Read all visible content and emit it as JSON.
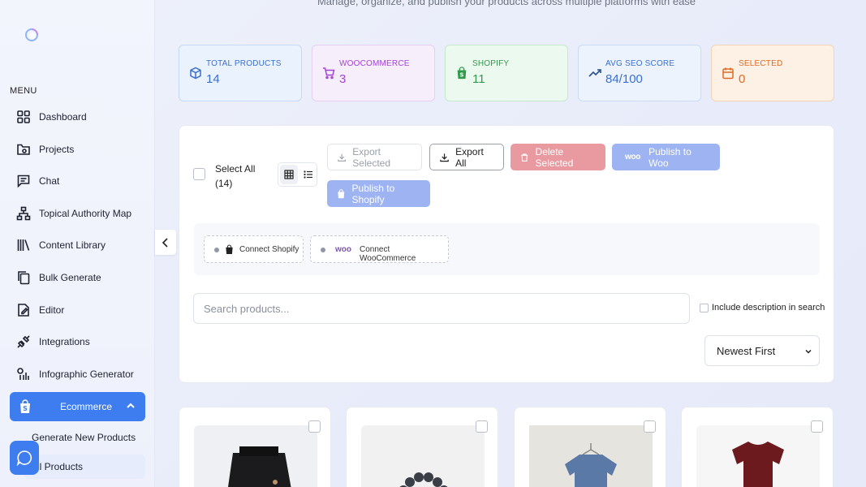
{
  "sidebar": {
    "menu_label": "MENU",
    "items": [
      {
        "label": "Dashboard"
      },
      {
        "label": "Projects"
      },
      {
        "label": "Chat"
      },
      {
        "label": "Topical Authority Map"
      },
      {
        "label": "Content Library"
      },
      {
        "label": "Bulk Generate"
      },
      {
        "label": "Editor"
      },
      {
        "label": "Integrations"
      },
      {
        "label": "Infographic Generator"
      }
    ],
    "active_group": {
      "label": "Ecommerce"
    },
    "sub_items": [
      {
        "label": "Generate New Products"
      },
      {
        "label": "ll Products"
      }
    ]
  },
  "header": {
    "subtitle": "Manage, organize, and publish your products across multiple platforms with ease"
  },
  "stats": [
    {
      "title": "TOTAL PRODUCTS",
      "value": "14"
    },
    {
      "title": "WOOCOMMERCE",
      "value": "3"
    },
    {
      "title": "SHOPIFY",
      "value": "11"
    },
    {
      "title": "AVG SEO SCORE",
      "value": "84/100"
    },
    {
      "title": "SELECTED",
      "value": "0"
    }
  ],
  "toolbar": {
    "select_all_line1": "Select All",
    "select_all_line2": "(14)",
    "export_selected": "Export Selected",
    "export_all": "Export All",
    "delete_selected": "Delete Selected",
    "woo_logo_text": "woo",
    "publish_woo": "Publish to Woo",
    "publish_shopify": "Publish to Shopify"
  },
  "connections": {
    "shopify": "Connect Shopify",
    "woo_logo_text": "woo",
    "woocommerce": "Connect WooCommerce"
  },
  "search": {
    "placeholder": "Search products...",
    "include_desc": "Include description in search"
  },
  "sort": {
    "selected": "Newest First"
  },
  "colors": {
    "accent": "#3d7df0",
    "stat_blue": "#3b6fd0",
    "stat_purple": "#a144d6",
    "stat_green": "#2f9a4a",
    "stat_orange": "#dd6a22",
    "delete_bg": "#e89aa0",
    "publish_bg": "#9db3f2"
  }
}
